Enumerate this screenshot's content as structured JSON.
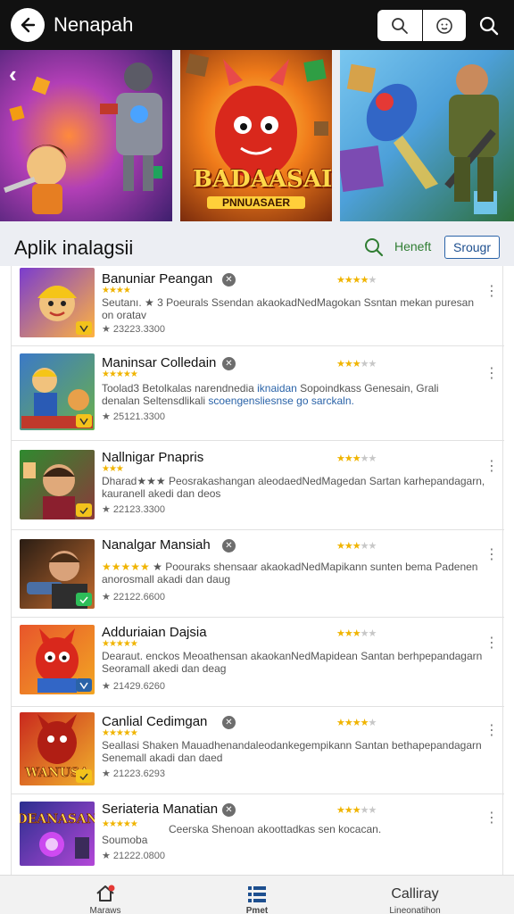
{
  "header": {
    "title": "Nenapah",
    "back_icon": "arrow-left-icon",
    "search_icon": "search-icon",
    "emoji_icon": "smiley-icon"
  },
  "banner": {
    "logo": "BADAASAI",
    "logo_sub": "PNNUASAER"
  },
  "section": {
    "title": "Aplik inalagsii",
    "link_label": "Heneft",
    "button_label": "Srougr"
  },
  "apps": [
    {
      "title": "Banuniar Peangan",
      "rating": 4,
      "mini_stars": "★★★★",
      "desc_line1": "Seutanı. ★ 3  Poeurals Ssendan akaokadNedMagokan Ssntan mekan puresan",
      "desc_line2": "on oratav",
      "meta": "23223.3300",
      "thumb_colors": [
        "#7a3ccf",
        "#ffb340"
      ]
    },
    {
      "title": "Maninsar Colledain",
      "rating": 3,
      "mini_stars": "★★★★★",
      "desc_line1": "Toolad3 Betolkalas narendnedia ",
      "desc_highlight1": "iknaidan",
      "desc_line1b": " Sopoindkass Genesain, Grali",
      "desc_line2": "denalan Seltensdlikali ",
      "desc_highlight2": "scoengensliesnse go sarckaln.",
      "meta": "25121.3300",
      "thumb_colors": [
        "#3b79c7",
        "#6ab04c"
      ]
    },
    {
      "title": "Nallnigar Pnapris",
      "rating": 3,
      "mini_stars": "★★★",
      "desc_line1": "Dharad★★★ Peosrakashangan aleodaedNedMagedan Sartan karhepandagarn,",
      "desc_line2": "kauranell akedi dan deos",
      "meta": "22123.3300",
      "thumb_colors": [
        "#2f8a2f",
        "#8b3a3a"
      ]
    },
    {
      "title": "Nanalgar Mansiah",
      "rating": 3,
      "mini_stars": "★★★★★",
      "desc_line1": "★ Poouraks shensaar akaokadNedMapikann sunten bema Padenen",
      "desc_line2": "anorosmall akadi dan daug",
      "meta": "22122.6600",
      "thumb_colors": [
        "#2a1d14",
        "#c06a2e"
      ]
    },
    {
      "title": "Adduriaian Dajsia",
      "rating": 3,
      "mini_stars": "★★★★★",
      "desc_line1": "Dearaut. enckos Meoathensan akaokanNedMapidean Santan berhpepandagarn",
      "desc_line2": "Seoramall akedi dan deag",
      "meta": "21429.6260",
      "thumb_colors": [
        "#e8552b",
        "#f2a623"
      ]
    },
    {
      "title": "Canlial Cedimgan",
      "rating": 4,
      "mini_stars": "★★★★★",
      "desc_line1": "Seallasi Shaken Mauadhenandaleodankegempikann Santan bethapepandagarn",
      "desc_line2": "Senemall akadi dan daed",
      "meta": "21223.6293",
      "thumb_colors": [
        "#c9281e",
        "#f1b22c"
      ]
    },
    {
      "title": "Seriateria Manatian",
      "rating": 3,
      "mini_stars": "★★★★★",
      "desc_line1": "Ceerska Shenoan akoottadkas sen kocacan.",
      "desc_line2": "Soumoba",
      "meta": "21222.0800",
      "thumb_colors": [
        "#2b2f8f",
        "#b347d8"
      ]
    }
  ],
  "bottom_nav": [
    {
      "label": "Maraws",
      "icon": "home-icon"
    },
    {
      "label": "Pmet",
      "icon": "list-icon"
    },
    {
      "label": "Calliray",
      "sublabel": "Lineonatihon",
      "icon": "none"
    }
  ]
}
